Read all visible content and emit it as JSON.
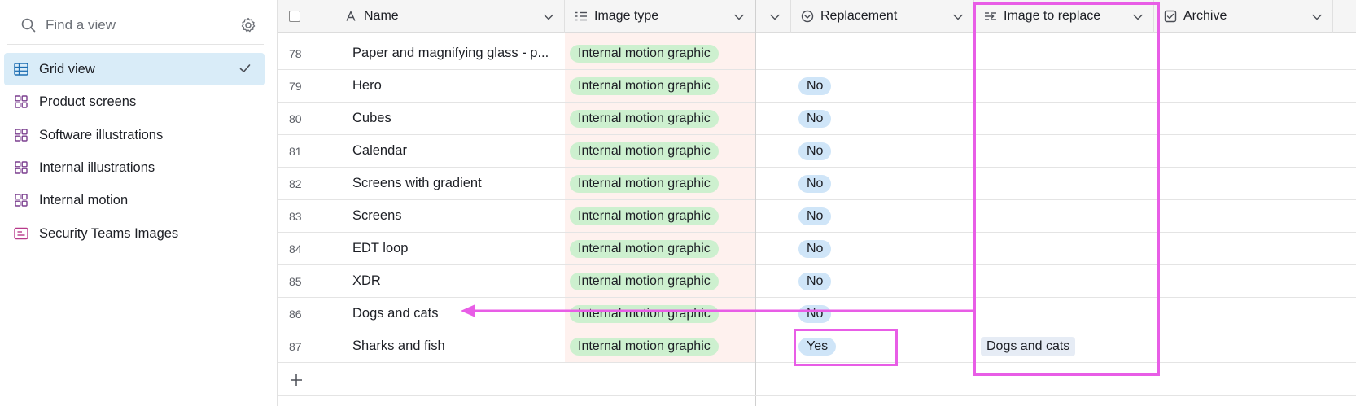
{
  "sidebar": {
    "search_placeholder": "Find a view",
    "items": [
      {
        "label": "Grid view",
        "icon": "grid-icon",
        "active": true
      },
      {
        "label": "Product screens",
        "icon": "gallery-icon"
      },
      {
        "label": "Software illustrations",
        "icon": "gallery-icon"
      },
      {
        "label": "Internal illustrations",
        "icon": "gallery-icon"
      },
      {
        "label": "Internal motion",
        "icon": "gallery-icon"
      },
      {
        "label": "Security Teams Images",
        "icon": "form-icon"
      }
    ]
  },
  "grid": {
    "columns": {
      "name": "Name",
      "image_type": "Image type",
      "replacement": "Replacement",
      "image_to_replace": "Image to replace",
      "archive": "Archive"
    },
    "rows": [
      {
        "num": "78",
        "name": "Paper and magnifying glass - p...",
        "image_type": "Internal motion graphic",
        "replacement": "",
        "image_to_replace": ""
      },
      {
        "num": "79",
        "name": "Hero",
        "image_type": "Internal motion graphic",
        "replacement": "No",
        "image_to_replace": ""
      },
      {
        "num": "80",
        "name": "Cubes",
        "image_type": "Internal motion graphic",
        "replacement": "No",
        "image_to_replace": ""
      },
      {
        "num": "81",
        "name": "Calendar",
        "image_type": "Internal motion graphic",
        "replacement": "No",
        "image_to_replace": ""
      },
      {
        "num": "82",
        "name": "Screens with gradient",
        "image_type": "Internal motion graphic",
        "replacement": "No",
        "image_to_replace": ""
      },
      {
        "num": "83",
        "name": "Screens",
        "image_type": "Internal motion graphic",
        "replacement": "No",
        "image_to_replace": ""
      },
      {
        "num": "84",
        "name": "EDT loop",
        "image_type": "Internal motion graphic",
        "replacement": "No",
        "image_to_replace": ""
      },
      {
        "num": "85",
        "name": "XDR",
        "image_type": "Internal motion graphic",
        "replacement": "No",
        "image_to_replace": ""
      },
      {
        "num": "86",
        "name": "Dogs and cats",
        "image_type": "Internal motion graphic",
        "replacement": "No",
        "image_to_replace": ""
      },
      {
        "num": "87",
        "name": "Sharks and fish",
        "image_type": "Internal motion graphic",
        "replacement": "Yes",
        "image_to_replace": "Dogs and cats"
      }
    ]
  },
  "colors": {
    "accent_selection": "#d9ecf8",
    "annotation": "#e85de6",
    "pill_green": "#cdf0cf",
    "pill_blue": "#cfe5f8"
  }
}
